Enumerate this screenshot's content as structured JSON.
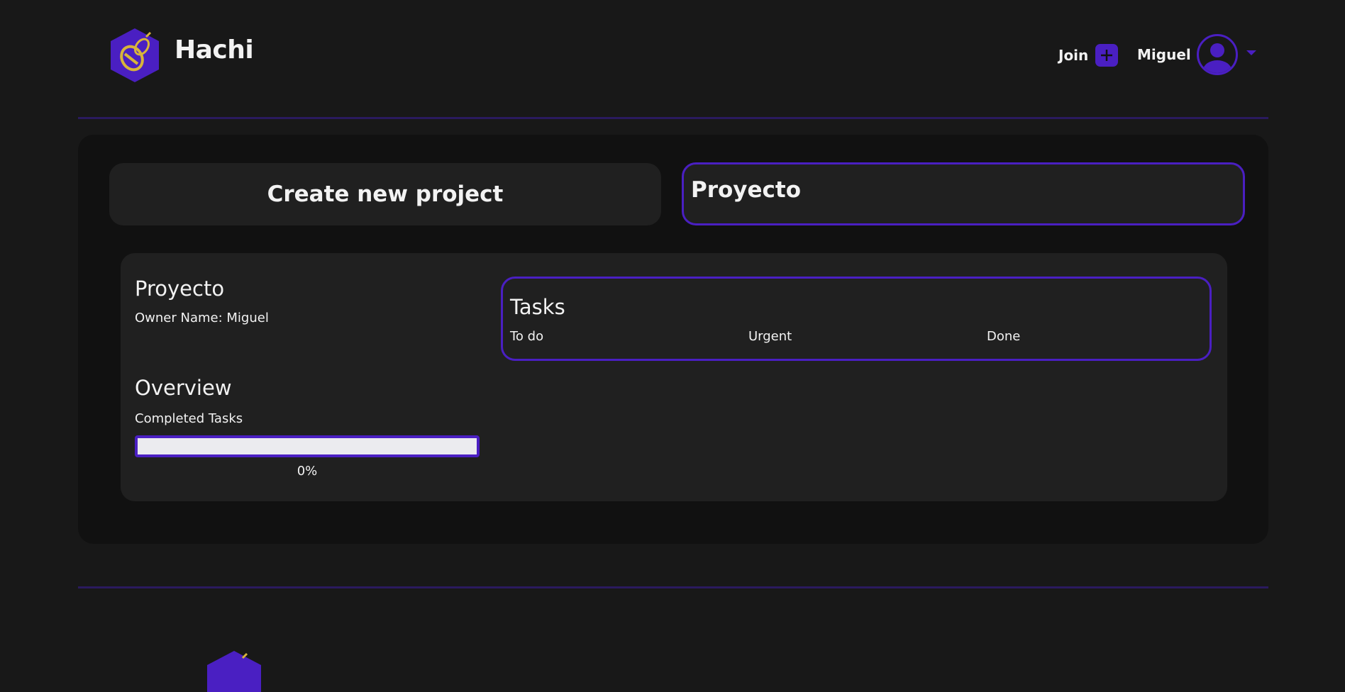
{
  "header": {
    "brand": "Hachi",
    "join_label": "Join",
    "user_name": "Miguel"
  },
  "icons": {
    "logo": "bee-hexagon-logo",
    "join": "plus-icon",
    "avatar": "user-avatar-icon",
    "caret": "caret-down-icon"
  },
  "colors": {
    "accent": "#4a1fc2",
    "logo_bee": "#d8b43a",
    "background": "#181818",
    "panel": "#111111",
    "card": "#202020"
  },
  "projects": {
    "create_label": "Create new project",
    "selected_name": "Proyecto"
  },
  "detail": {
    "title": "Proyecto",
    "owner": "Owner Name: Miguel",
    "overview_title": "Overview",
    "completed_label": "Completed Tasks",
    "progress_value": 0,
    "progress_text": "0%"
  },
  "tasks": {
    "title": "Tasks",
    "columns": [
      "To do",
      "Urgent",
      "Done"
    ]
  }
}
